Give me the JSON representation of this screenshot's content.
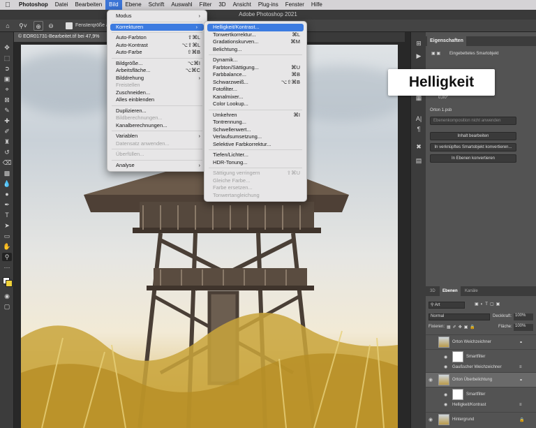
{
  "menubar": {
    "app": "Photoshop",
    "items": [
      "Datei",
      "Bearbeiten",
      "Bild",
      "Ebene",
      "Schrift",
      "Auswahl",
      "Filter",
      "3D",
      "Ansicht",
      "Plug-ins",
      "Fenster",
      "Hilfe"
    ],
    "active": "Bild"
  },
  "window": {
    "title": "Adobe Photoshop 2021"
  },
  "options": {
    "fit_label": "Fensterqröße a"
  },
  "document": {
    "tab_label": "© EOR01731-Bearbeitet.tif bei 47,9%"
  },
  "bild_menu": [
    {
      "label": "Modus",
      "submenu": true
    },
    {
      "sep": true
    },
    {
      "label": "Korrekturen",
      "submenu": true,
      "open": true
    },
    {
      "sep": true
    },
    {
      "label": "Auto-Farbton",
      "shortcut": "⇧⌘L"
    },
    {
      "label": "Auto-Kontrast",
      "shortcut": "⌥⇧⌘L"
    },
    {
      "label": "Auto-Farbe",
      "shortcut": "⇧⌘B"
    },
    {
      "sep": true
    },
    {
      "label": "Bildgröße...",
      "shortcut": "⌥⌘I"
    },
    {
      "label": "Arbeitsfläche...",
      "shortcut": "⌥⌘C"
    },
    {
      "label": "Bilddrehung",
      "submenu": true
    },
    {
      "label": "Freistellen",
      "disabled": true
    },
    {
      "label": "Zuschneiden..."
    },
    {
      "label": "Alles einblenden"
    },
    {
      "sep": true
    },
    {
      "label": "Duplizieren..."
    },
    {
      "label": "Bildberechnungen...",
      "disabled": true
    },
    {
      "label": "Kanalberechnungen..."
    },
    {
      "sep": true
    },
    {
      "label": "Variablen",
      "submenu": true
    },
    {
      "label": "Datensatz anwenden...",
      "disabled": true
    },
    {
      "sep": true
    },
    {
      "label": "Überfüllen...",
      "disabled": true
    },
    {
      "sep": true
    },
    {
      "label": "Analyse",
      "submenu": true
    }
  ],
  "korrekturen_menu": [
    {
      "label": "Helligkeit/Kontrast...",
      "highlighted": true
    },
    {
      "label": "Tonwertkorrektur...",
      "shortcut": "⌘L"
    },
    {
      "label": "Gradationskurven...",
      "shortcut": "⌘M"
    },
    {
      "label": "Belichtung..."
    },
    {
      "sep": true
    },
    {
      "label": "Dynamik..."
    },
    {
      "label": "Farbton/Sättigung...",
      "shortcut": "⌘U"
    },
    {
      "label": "Farbbalance...",
      "shortcut": "⌘B"
    },
    {
      "label": "Schwarzweiß...",
      "shortcut": "⌥⇧⌘B"
    },
    {
      "label": "Fotofilter..."
    },
    {
      "label": "Kanalmixer..."
    },
    {
      "label": "Color Lookup..."
    },
    {
      "sep": true
    },
    {
      "label": "Umkehren",
      "shortcut": "⌘I"
    },
    {
      "label": "Tontrennung..."
    },
    {
      "label": "Schwellenwert..."
    },
    {
      "label": "Verlaufsumsetzung..."
    },
    {
      "label": "Selektive Farbkorrektur..."
    },
    {
      "sep": true
    },
    {
      "label": "Tiefen/Lichter..."
    },
    {
      "label": "HDR-Tonung..."
    },
    {
      "sep": true
    },
    {
      "label": "Sättigung verringern",
      "shortcut": "⇧⌘U",
      "disabled": true
    },
    {
      "label": "Gleiche Farbe...",
      "disabled": true
    },
    {
      "label": "Farbe ersetzen...",
      "disabled": true
    },
    {
      "label": "Tonwertangleichung",
      "disabled": true
    }
  ],
  "callout": {
    "text": "Helligkeit"
  },
  "properties": {
    "tab": "Eigenschaften",
    "object_label": "Eingebettetes Smartobjekt",
    "angle": "0,00°",
    "source": "Orton 1.psb",
    "comp_placeholder": "Ebenenkomposition nicht anwenden",
    "btn_edit": "Inhalt bearbeiten",
    "btn_convert_linked": "In verknüpftes Smartobjekt konvertieren...",
    "btn_convert_layers": "In Ebenen konvertieren"
  },
  "layers": {
    "tabs": [
      "3D",
      "Ebenen",
      "Kanäle"
    ],
    "active_tab": "Ebenen",
    "filter_kind": "Art",
    "blend_mode": "Normal",
    "opacity_label": "Deckkraft:",
    "opacity": "100%",
    "lock_label": "Fixieren:",
    "fill_label": "Fläche:",
    "fill": "100%",
    "rows": [
      {
        "name": "Orton Weichzeichner",
        "type": "smart",
        "visible": false
      },
      {
        "name": "Smartfilter",
        "type": "filtermask"
      },
      {
        "name": "Gaußscher Weichzeichner",
        "type": "filter"
      },
      {
        "name": "Orton Überbelichtung",
        "type": "smart",
        "visible": true,
        "selected": true
      },
      {
        "name": "Smartfilter",
        "type": "filtermask"
      },
      {
        "name": "Helligkeit/Kontrast",
        "type": "filter"
      },
      {
        "name": "Hintergrund",
        "type": "background",
        "visible": true
      }
    ]
  }
}
